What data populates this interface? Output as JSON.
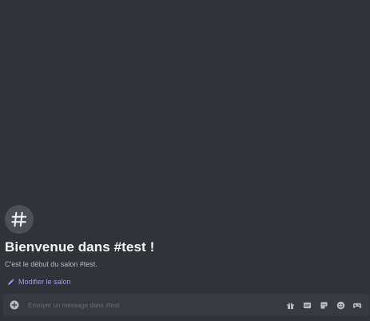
{
  "channel": {
    "hash_symbol": "#",
    "welcome_title": "Bienvenue dans #test !",
    "welcome_subtitle": "C'est le début du salon #test.",
    "edit_link": "Modifier le salon"
  },
  "composer": {
    "placeholder": "Envoyer un message dans #test",
    "value": "",
    "tools": [
      "gift-icon",
      "gif-icon",
      "sticker-icon",
      "emoji-icon",
      "apps-icon"
    ]
  },
  "colors": {
    "background": "#313338",
    "composer_bg": "#383a40",
    "link": "#949cf7",
    "title": "#f2f3f5",
    "icon": "#b5bac1"
  }
}
